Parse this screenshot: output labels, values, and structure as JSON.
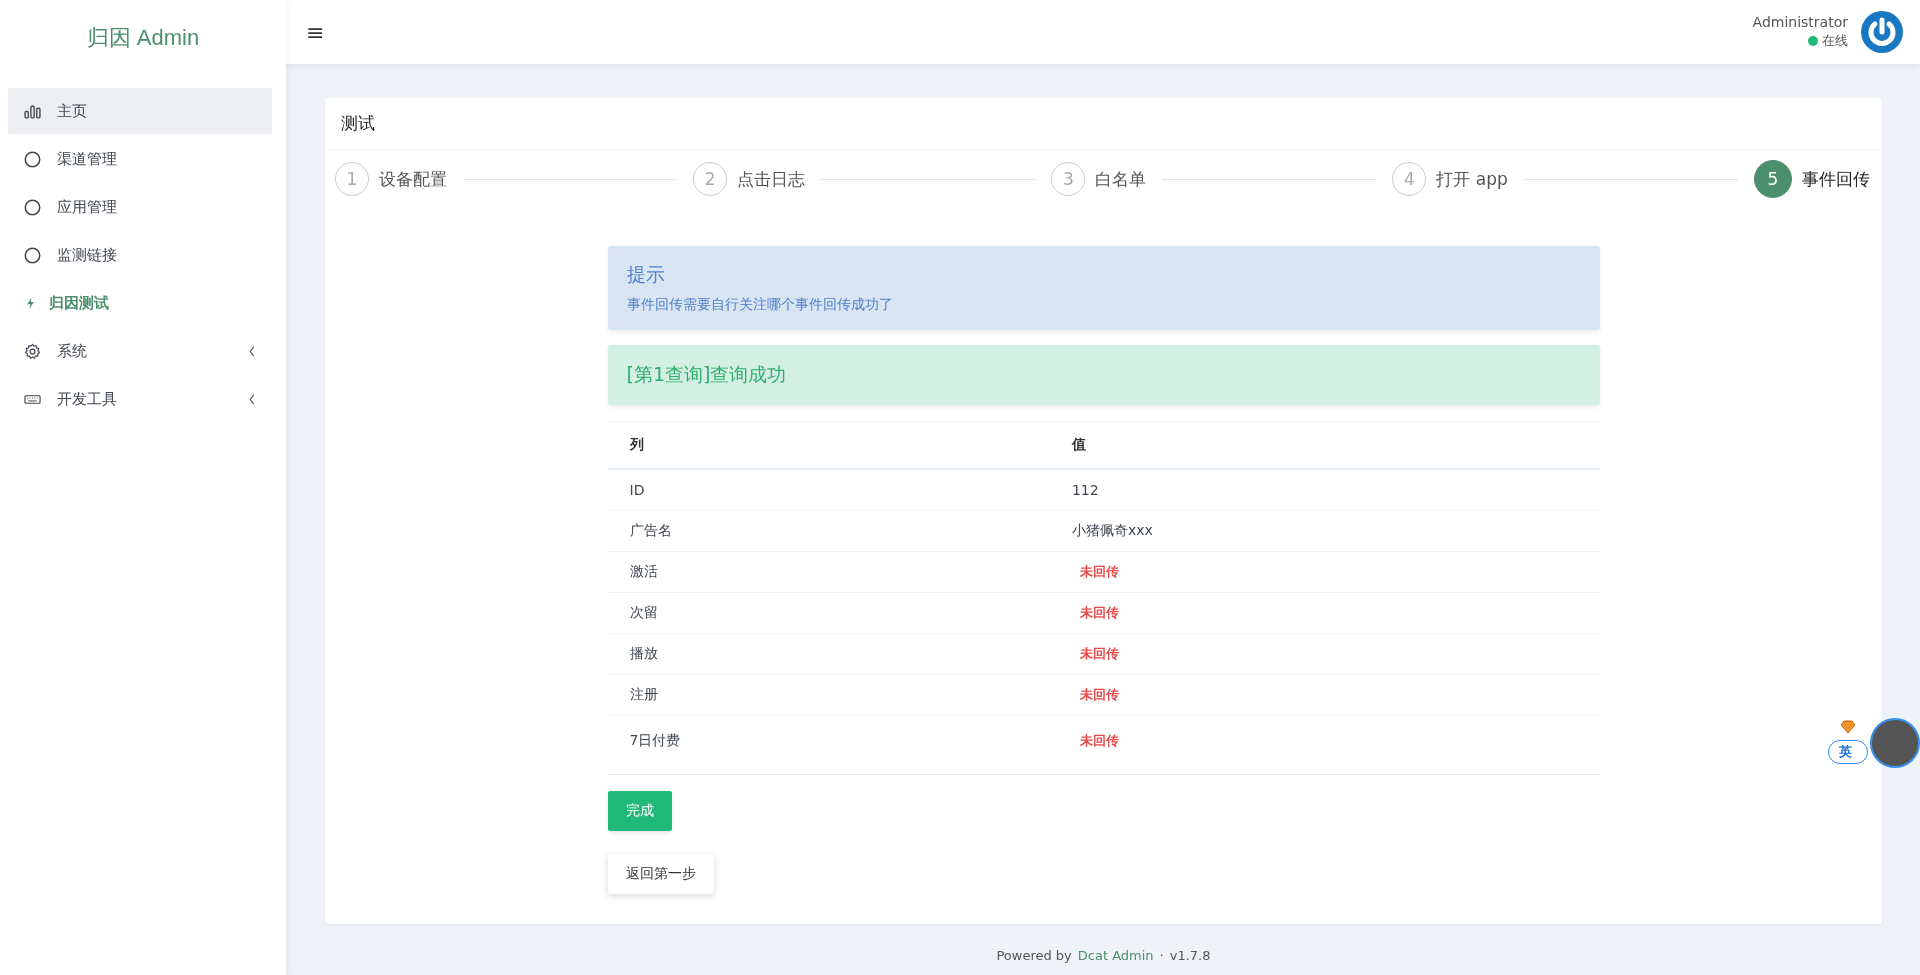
{
  "sidebar": {
    "logo": "归因 Admin",
    "items": [
      {
        "label": "主页",
        "kind": "chart",
        "hovered": true,
        "selected": false,
        "has_children": false
      },
      {
        "label": "渠道管理",
        "kind": "circle",
        "hovered": false,
        "selected": false,
        "has_children": false
      },
      {
        "label": "应用管理",
        "kind": "circle",
        "hovered": false,
        "selected": false,
        "has_children": false
      },
      {
        "label": "监测链接",
        "kind": "circle",
        "hovered": false,
        "selected": false,
        "has_children": false
      },
      {
        "label": "归因测试",
        "kind": "bolt",
        "hovered": false,
        "selected": true,
        "has_children": false
      },
      {
        "label": "系统",
        "kind": "gear",
        "hovered": false,
        "selected": false,
        "has_children": true
      },
      {
        "label": "开发工具",
        "kind": "keyboard",
        "hovered": false,
        "selected": false,
        "has_children": true
      }
    ]
  },
  "header": {
    "menu_icon": "≡",
    "user": {
      "name": "Administrator",
      "status": "在线"
    }
  },
  "card": {
    "title": "测试",
    "steps": [
      {
        "number": "1",
        "label": "设备配置",
        "selected": false
      },
      {
        "number": "2",
        "label": "点击日志",
        "selected": false
      },
      {
        "number": "3",
        "label": "白名单",
        "selected": false
      },
      {
        "number": "4",
        "label": "打开 app",
        "selected": false
      },
      {
        "number": "5",
        "label": "事件回传",
        "selected": true
      }
    ],
    "notice": {
      "title": "提示",
      "text": "事件回传需要自行关注哪个事件回传成功了"
    },
    "success": {
      "text": "[第1查询]查询成功"
    },
    "table": {
      "columns": [
        "列",
        "值"
      ],
      "rows": [
        {
          "column": "ID",
          "value": "112",
          "kind": "text"
        },
        {
          "column": "广告名",
          "value": "小猪佩奇xxx",
          "kind": "text"
        },
        {
          "column": "激活",
          "value": "未回传",
          "kind": "status"
        },
        {
          "column": "次留",
          "value": "未回传",
          "kind": "status"
        },
        {
          "column": "播放",
          "value": "未回传",
          "kind": "status"
        },
        {
          "column": "注册",
          "value": "未回传",
          "kind": "status"
        },
        {
          "column": "7日付费",
          "value": "未回传",
          "kind": "status"
        }
      ]
    },
    "buttons": [
      {
        "label": "完成",
        "kind": "primary"
      },
      {
        "label": "返回第一步",
        "kind": "default"
      }
    ]
  },
  "footer": {
    "prefix": "Powered by",
    "link": "Dcat Admin",
    "separator": "·",
    "version": "v1.7.8"
  },
  "ime_widget": {
    "label": "英"
  }
}
